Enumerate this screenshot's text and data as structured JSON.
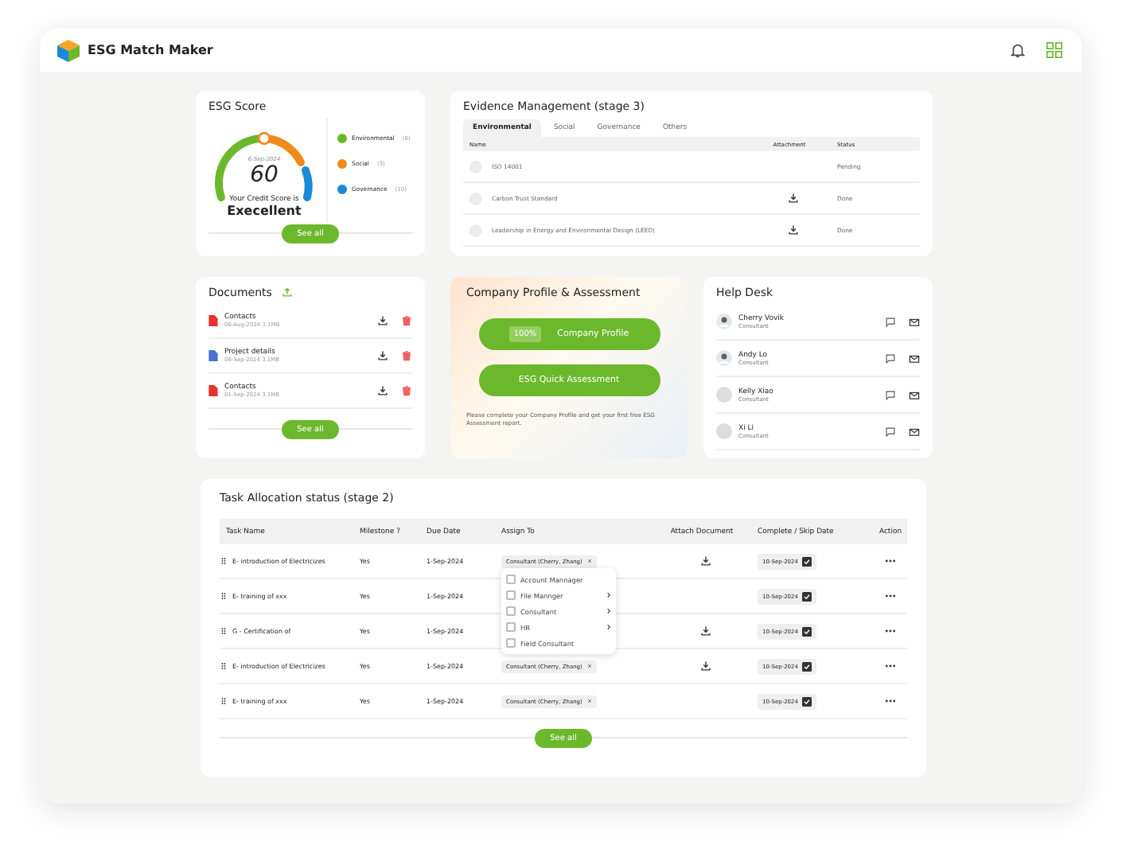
{
  "app": {
    "title": "ESG Match Maker"
  },
  "esg_score": {
    "title": "ESG Score",
    "date": "6-Sep-2024",
    "score": "60",
    "caption": "Your Credit Score is",
    "rating": "Execellent",
    "button": "See all",
    "legend": [
      {
        "label": "Environmental",
        "count": "(6)",
        "color": "#6cb82c"
      },
      {
        "label": "Social",
        "count": "(3)",
        "color": "#f08a1c"
      },
      {
        "label": "Governance",
        "count": "(10)",
        "color": "#1a8ad8"
      }
    ]
  },
  "evidence": {
    "title": "Evidence Management  (stage 3)",
    "tabs": [
      {
        "label": "Environmental",
        "selected": true
      },
      {
        "label": "Social",
        "selected": false
      },
      {
        "label": "Governance",
        "selected": false
      },
      {
        "label": "Others",
        "selected": false
      }
    ],
    "columns": [
      "Name",
      "Attachment",
      "Status"
    ],
    "rows": [
      {
        "name": "ISO 14001",
        "attachment": false,
        "status": "Pending"
      },
      {
        "name": "Carbon Trust Standard",
        "attachment": true,
        "status": "Done"
      },
      {
        "name": "Leadership in Energy and Environmental Design (LEED)",
        "attachment": true,
        "status": "Done"
      }
    ]
  },
  "documents": {
    "title": "Documents",
    "button": "See all",
    "items": [
      {
        "name": "Contacts",
        "meta": "06-Aug-2024   3.1MB",
        "color": "#e8322c"
      },
      {
        "name": "Project details",
        "meta": "06-Sep-2024   3.1MB",
        "color": "#4a6fd8"
      },
      {
        "name": "Contacts",
        "meta": "01-Sep-2024   3.1MB",
        "color": "#e8322c"
      }
    ]
  },
  "company": {
    "title": "Company Profile & Assessment",
    "progress": "100%",
    "profile_button": "Company  Profile",
    "assessment_button": "ESG Quick Assessment",
    "note": "Please complete your Company Profile and get your first free ESG Assessment report."
  },
  "help_desk": {
    "title": "Help Desk",
    "people": [
      {
        "name": "Cherry Vovik",
        "role": "Consultant",
        "photo": true
      },
      {
        "name": "Andy Lo",
        "role": "Consultant",
        "photo": true
      },
      {
        "name": "Kelly Xiao",
        "role": "Consultant",
        "photo": false
      },
      {
        "name": "Xi Li",
        "role": "Consultant",
        "photo": false
      }
    ]
  },
  "tasks": {
    "title": "Task Allocation status  (stage 2)",
    "button": "See all",
    "columns": [
      "Task Name",
      "Milestone ?",
      "Due Date",
      "Assign To",
      "Attach Document",
      "Complete / Skip Date",
      "Action"
    ],
    "rows": [
      {
        "name": "E- introduction of Electricizes",
        "milestone": "Yes",
        "due": "1-Sep-2024",
        "assign": "Consultant (Cherry, Zhang)",
        "attachment": true,
        "done": "10-Sep-2024",
        "checked": true
      },
      {
        "name": "E- training of xxx",
        "milestone": "Yes",
        "due": "1-Sep-2024",
        "attachment": false,
        "done": "10-Sep-2024",
        "checked": true
      },
      {
        "name": "G - Certification of",
        "milestone": "Yes",
        "due": "1-Sep-2024",
        "attachment": true,
        "done": "10-Sep-2024",
        "checked": true
      },
      {
        "name": "E- introduction of Electricizes",
        "milestone": "Yes",
        "due": "1-Sep-2024",
        "assign": "Consultant (Cherry, Zhang)",
        "attachment": true,
        "done": "10-Sep-2024",
        "checked": true
      },
      {
        "name": "E- training of xxx",
        "milestone": "Yes",
        "due": "1-Sep-2024",
        "assign": "Consultant (Cherry, Zhang)",
        "attachment": false,
        "done": "10-Sep-2024",
        "checked": true
      }
    ],
    "menu": [
      {
        "label": "Account Mannager",
        "checked": false,
        "submenu": false
      },
      {
        "label": "File Mannger",
        "checked": false,
        "submenu": true
      },
      {
        "label": "Consultant",
        "checked": false,
        "submenu": true
      },
      {
        "label": "HR",
        "checked": false,
        "submenu": true
      },
      {
        "label": "Field Consultant",
        "checked": false,
        "submenu": false
      }
    ]
  }
}
